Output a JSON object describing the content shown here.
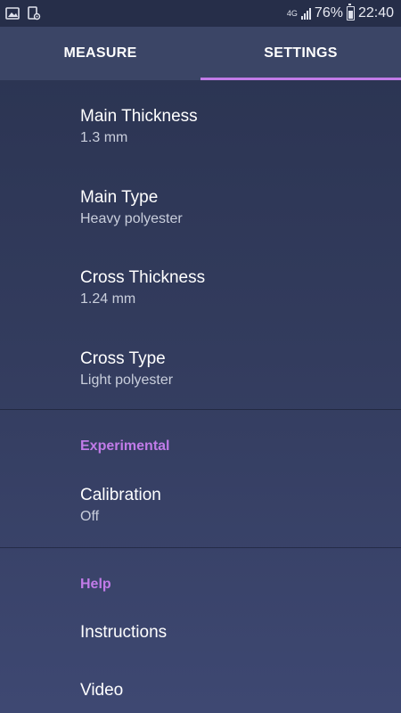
{
  "status_bar": {
    "network": "4G",
    "battery_percent": "76%",
    "time": "22:40",
    "left_icons": [
      "image-icon",
      "settings-file-icon"
    ]
  },
  "tabs": [
    {
      "label": "MEASURE",
      "active": false
    },
    {
      "label": "SETTINGS",
      "active": true
    }
  ],
  "settings": {
    "main_thickness": {
      "title": "Main Thickness",
      "summary": "1.3 mm"
    },
    "main_type": {
      "title": "Main Type",
      "summary": "Heavy polyester"
    },
    "cross_thickness": {
      "title": "Cross Thickness",
      "summary": "1.24 mm"
    },
    "cross_type": {
      "title": "Cross Type",
      "summary": "Light polyester"
    }
  },
  "experimental": {
    "header": "Experimental",
    "calibration": {
      "title": "Calibration",
      "summary": "Off"
    }
  },
  "help": {
    "header": "Help",
    "instructions": {
      "title": "Instructions"
    },
    "video": {
      "title": "Video"
    }
  },
  "colors": {
    "accent": "#c17be8",
    "background": "#333c5e",
    "tab_bar": "#3b4566",
    "status_bar": "#262e49"
  }
}
